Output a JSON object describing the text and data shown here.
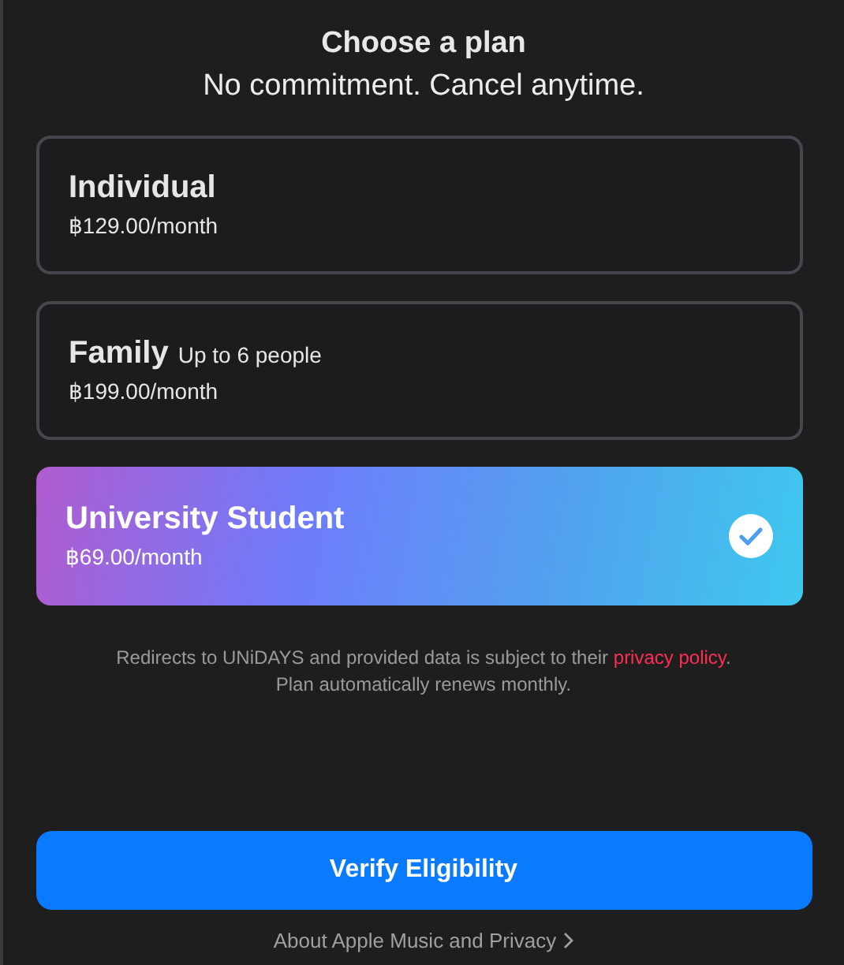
{
  "title": "Choose a plan",
  "subtitle": "No commitment. Cancel anytime.",
  "plans": [
    {
      "name": "Individual",
      "price": "฿129.00/month",
      "selected": false
    },
    {
      "name": "Family",
      "note": "Up to 6 people",
      "price": "฿199.00/month",
      "selected": false
    },
    {
      "name": "University Student",
      "price": "฿69.00/month",
      "selected": true
    }
  ],
  "disclaimer": {
    "before": "Redirects to UNiDAYS and provided data is subject to their ",
    "link": "privacy policy",
    "after": ".",
    "line2": "Plan automatically renews monthly."
  },
  "button": "Verify Eligibility",
  "footer_link": "About Apple Music and Privacy"
}
